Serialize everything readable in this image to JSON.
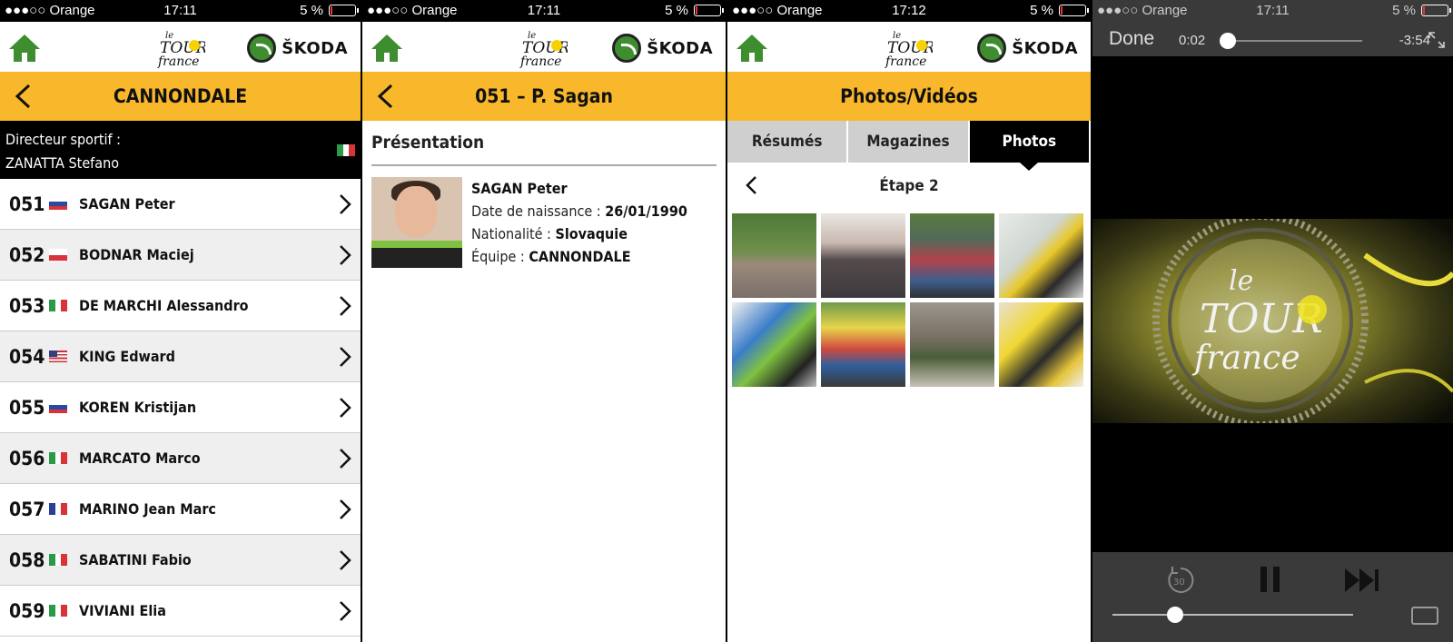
{
  "status_bars": [
    {
      "carrier": "●●●○○ Orange",
      "time": "17:11",
      "battery": "5 %"
    },
    {
      "carrier": "●●●○○ Orange",
      "time": "17:11",
      "battery": "5 %"
    },
    {
      "carrier": "●●●○○ Orange",
      "time": "17:12",
      "battery": "5 %"
    },
    {
      "carrier": "●●●○○ Orange",
      "time": "17:11",
      "battery": "5 %"
    }
  ],
  "brand": {
    "sponsor": "ŠKODA",
    "accent": "#f9b82c",
    "home_color": "#3e8e2f"
  },
  "team_screen": {
    "title": "CANNONDALE",
    "director_label": "Directeur sportif :",
    "director_name": "ZANATTA Stefano",
    "director_flag": "it",
    "riders": [
      {
        "num": "051",
        "name": "SAGAN Peter",
        "flag": "sk"
      },
      {
        "num": "052",
        "name": "BODNAR Maciej",
        "flag": "pl"
      },
      {
        "num": "053",
        "name": "DE MARCHI Alessandro",
        "flag": "it"
      },
      {
        "num": "054",
        "name": "KING Edward",
        "flag": "us"
      },
      {
        "num": "055",
        "name": "KOREN Kristijan",
        "flag": "si"
      },
      {
        "num": "056",
        "name": "MARCATO Marco",
        "flag": "it"
      },
      {
        "num": "057",
        "name": "MARINO Jean Marc",
        "flag": "fr"
      },
      {
        "num": "058",
        "name": "SABATINI Fabio",
        "flag": "it"
      },
      {
        "num": "059",
        "name": "VIVIANI Elia",
        "flag": "it"
      }
    ]
  },
  "rider_screen": {
    "title": "051 – P. Sagan",
    "section": "Présentation",
    "name": "SAGAN Peter",
    "birth_label": "Date de naissance : ",
    "birth_value": "26/01/1990",
    "nat_label": "Nationalité : ",
    "nat_value": "Slovaquie",
    "team_label": "Équipe : ",
    "team_value": "CANNONDALE"
  },
  "media_screen": {
    "title": "Photos/Vidéos",
    "tabs": [
      "Résumés",
      "Magazines",
      "Photos"
    ],
    "active_tab": 2,
    "stage": "Étape 2"
  },
  "player": {
    "done": "Done",
    "current": "0:02",
    "remaining": "-3:54",
    "progress": 0.01,
    "volume": 0.26,
    "skip_label": "30"
  }
}
